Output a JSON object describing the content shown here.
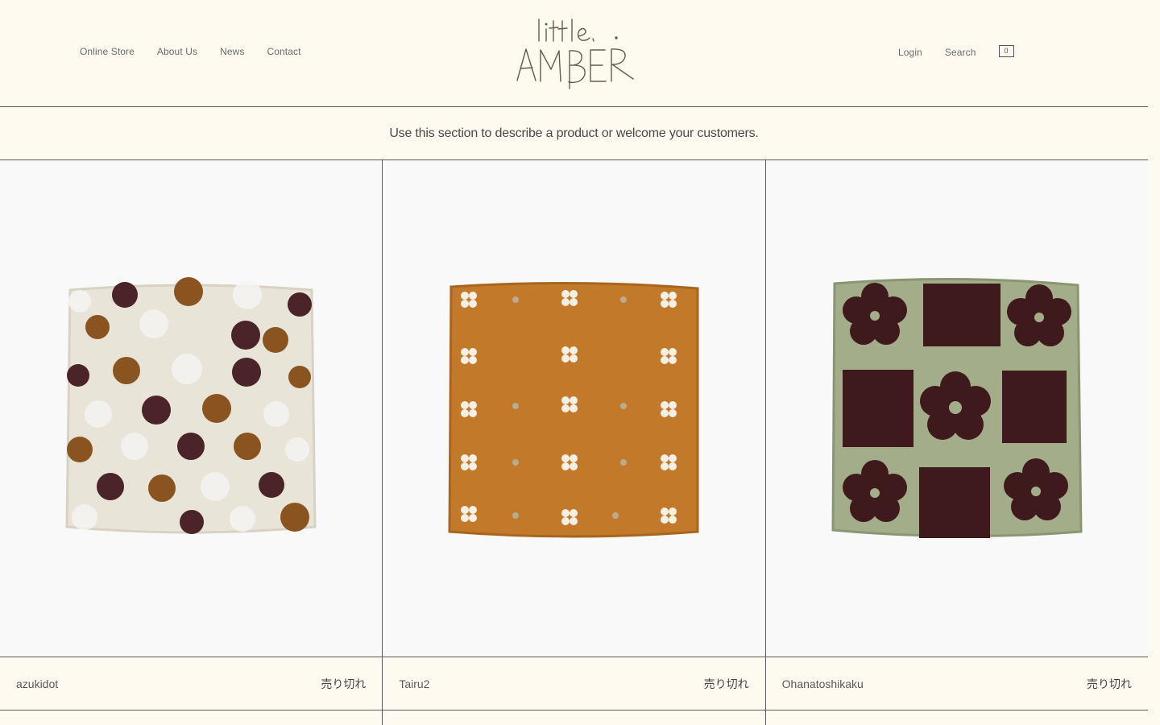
{
  "nav": {
    "left": [
      "Online Store",
      "About Us",
      "News",
      "Contact"
    ],
    "right": [
      "Login",
      "Search"
    ],
    "cart_count": "0"
  },
  "logo": {
    "line1": "little.",
    "line2": "AMBER"
  },
  "welcome": "Use this section to describe a product or welcome your customers.",
  "products": [
    {
      "name": "azukidot",
      "status": "売り切れ",
      "image": "polka-dot-towel"
    },
    {
      "name": "Tairu2",
      "status": "売り切れ",
      "image": "flower-tile-towel"
    },
    {
      "name": "Ohanatoshikaku",
      "status": "売り切れ",
      "image": "flower-square-towel"
    }
  ],
  "colors": {
    "background": "#fefaf0",
    "card_bg": "#f9f9f9",
    "border": "#5a5a5a"
  }
}
